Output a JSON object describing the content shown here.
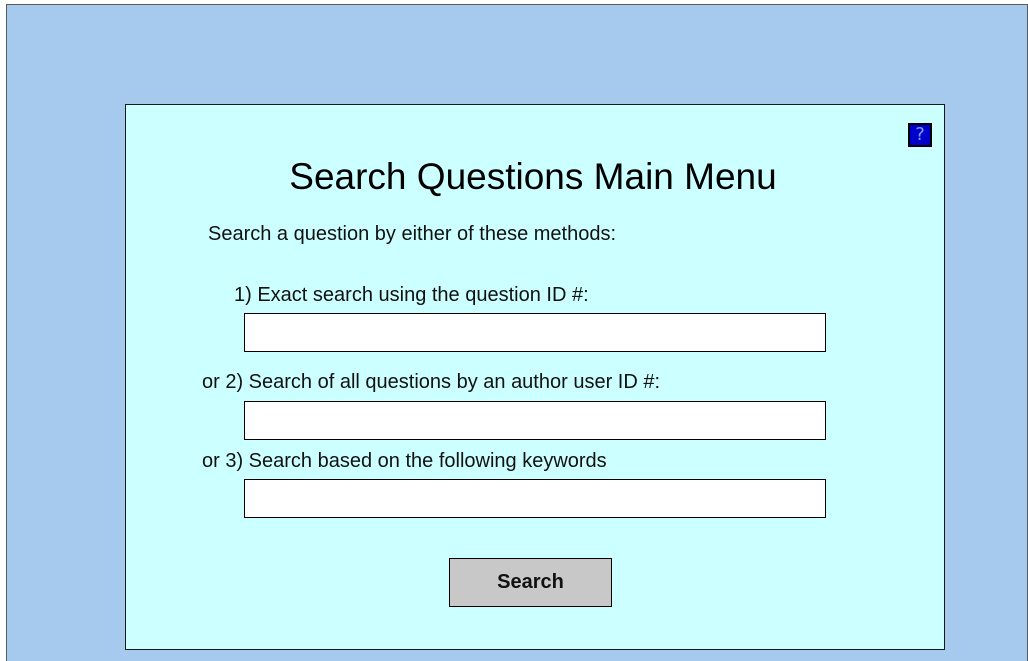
{
  "panel": {
    "help_button_label": "?",
    "title": "Search Questions Main Menu",
    "intro": "Search a question by either of these methods:",
    "methods": [
      {
        "label": "1) Exact search using the question ID #:",
        "value": ""
      },
      {
        "label": "or 2) Search of all questions by an author user ID #:",
        "value": ""
      },
      {
        "label": "or 3) Search based on the following keywords",
        "value": ""
      }
    ],
    "search_button_label": "Search"
  },
  "colors": {
    "background": "#a6c9ee",
    "panel": "#ccffff",
    "help_button": "#0000cc",
    "button": "#c8c8c8"
  }
}
